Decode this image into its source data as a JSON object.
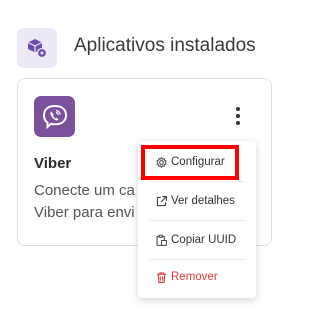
{
  "section": {
    "title": "Aplicativos instalados",
    "icon": "apps-gear-icon"
  },
  "app": {
    "name": "Viber",
    "description": "Conecte um ca\nViber para envi",
    "logo": "viber-logo",
    "brand_color": "#7b519d"
  },
  "menu": {
    "items": [
      {
        "label": "Configurar",
        "icon": "gear-icon"
      },
      {
        "label": "Ver detalhes",
        "icon": "external-link-icon"
      },
      {
        "label": "Copiar UUID",
        "icon": "copy-icon"
      },
      {
        "label": "Remover",
        "icon": "trash-icon",
        "color": "#e53935"
      }
    ]
  },
  "colors": {
    "highlight": "#ff0000",
    "accent": "#7b519d",
    "section_icon_bg": "#ece8f6"
  }
}
